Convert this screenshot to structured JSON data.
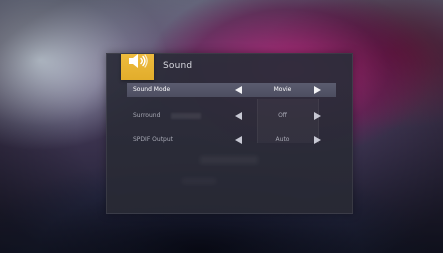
{
  "dialog": {
    "title": "Sound",
    "icon": "speaker-icon",
    "accent_color": "#f0bb3b"
  },
  "settings": [
    {
      "label": "Sound Mode",
      "value": "Movie",
      "selected": true
    },
    {
      "label": "Surround",
      "value": "Off",
      "selected": false
    },
    {
      "label": "SPDIF Output",
      "value": "Auto",
      "selected": false
    }
  ]
}
